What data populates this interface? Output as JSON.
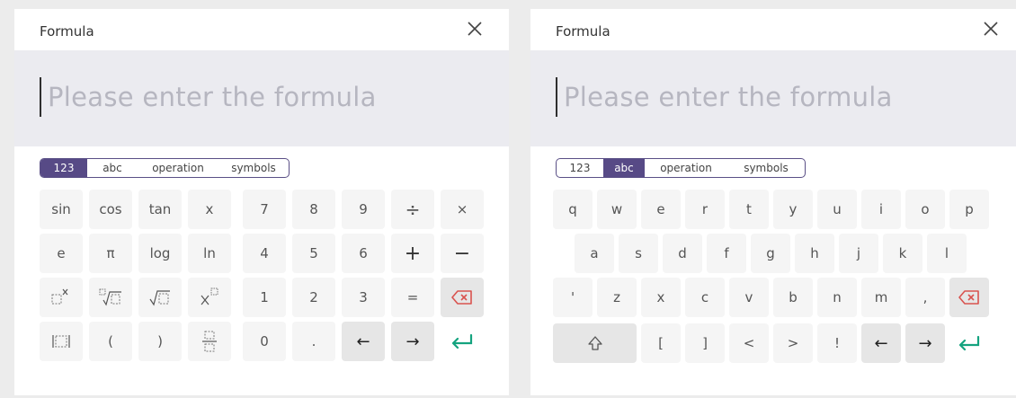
{
  "left": {
    "title": "Formula",
    "placeholder": "Please enter the formula",
    "tabs": [
      "123",
      "abc",
      "operation",
      "symbols"
    ],
    "active_tab": "123",
    "keys": {
      "sin": "sin",
      "cos": "cos",
      "tan": "tan",
      "x": "x",
      "seven": "7",
      "eight": "8",
      "nine": "9",
      "divide": "÷",
      "multiply": "×",
      "e": "e",
      "pi": "π",
      "log": "log",
      "ln": "ln",
      "four": "4",
      "five": "5",
      "six": "6",
      "plus": "+",
      "minus": "−",
      "one": "1",
      "two": "2",
      "three": "3",
      "equals": "=",
      "open_paren": "(",
      "close_paren": ")",
      "zero": "0",
      "dot": ".",
      "left_arrow": "←",
      "right_arrow": "→"
    }
  },
  "right": {
    "title": "Formula",
    "placeholder": "Please enter the formula",
    "tabs": [
      "123",
      "abc",
      "operation",
      "symbols"
    ],
    "active_tab": "abc",
    "row1": [
      "q",
      "w",
      "e",
      "r",
      "t",
      "y",
      "u",
      "i",
      "o",
      "p"
    ],
    "row2": [
      "a",
      "s",
      "d",
      "f",
      "g",
      "h",
      "j",
      "k",
      "l"
    ],
    "row3": [
      "'",
      "z",
      "x",
      "c",
      "v",
      "b",
      "n",
      "m",
      ","
    ],
    "row4": [
      "[",
      "]",
      "<",
      ">",
      "!"
    ],
    "left_arrow": "←",
    "right_arrow": "→"
  },
  "colors": {
    "accent": "#574a86",
    "enter": "#14a37f",
    "backspace": "#d9534f",
    "input_bg": "#ebebf0"
  },
  "icons": [
    "close-icon",
    "backspace-icon",
    "enter-icon",
    "shift-icon",
    "power-icon",
    "nth-root-icon",
    "sqrt-icon",
    "subscript-icon",
    "abs-icon",
    "fraction-icon"
  ]
}
